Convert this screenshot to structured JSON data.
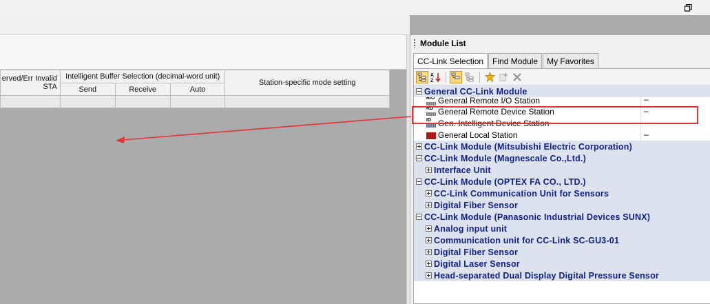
{
  "grid": {
    "col_reserved": "erved/Err Invalid STA",
    "col_buffer": "Intelligent Buffer Selection (decimal-word unit)",
    "col_send": "Send",
    "col_receive": "Receive",
    "col_auto": "Auto",
    "col_station_mode": "Station-specific mode setting"
  },
  "module_list": {
    "title": "Module List",
    "tabs": [
      {
        "label": "CC-Link Selection",
        "active": true
      },
      {
        "label": "Find Module",
        "active": false
      },
      {
        "label": "My Favorites",
        "active": false
      }
    ],
    "toolbar": {
      "sort_icon": "sort-az-icon",
      "favorite_icon": "star-icon",
      "add_icon": "add-icon",
      "delete_icon": "delete-icon"
    },
    "rows": [
      {
        "kind": "cat",
        "expander": "minus",
        "label": "General CC-Link Module"
      },
      {
        "kind": "item",
        "icon": "RIO",
        "label": "General Remote I/O Station",
        "value": "–"
      },
      {
        "kind": "item",
        "icon": "RD",
        "label": "General Remote Device Station",
        "value": "–"
      },
      {
        "kind": "item",
        "icon": "ID",
        "label": "Gen. Intelligent Device Station",
        "value": "–"
      },
      {
        "kind": "item",
        "icon": "LOCAL",
        "label": "General Local Station",
        "value": "–"
      },
      {
        "kind": "cat",
        "expander": "plus",
        "label": "CC-Link Module (Mitsubishi Electric Corporation)"
      },
      {
        "kind": "cat",
        "expander": "minus",
        "label": "CC-Link Module (Magnescale Co.,Ltd.)"
      },
      {
        "kind": "sub",
        "expander": "plus",
        "label": "Interface Unit"
      },
      {
        "kind": "cat",
        "expander": "minus",
        "label": "CC-Link Module (OPTEX FA CO., LTD.)"
      },
      {
        "kind": "sub",
        "expander": "plus",
        "label": "CC-Link Communication Unit for Sensors"
      },
      {
        "kind": "sub",
        "expander": "plus",
        "label": "Digital Fiber Sensor"
      },
      {
        "kind": "cat",
        "expander": "minus",
        "label": "CC-Link Module (Panasonic Industrial Devices SUNX)"
      },
      {
        "kind": "sub",
        "expander": "plus",
        "label": "Analog input unit"
      },
      {
        "kind": "sub",
        "expander": "plus",
        "label": "Communication unit for CC-Link SC-GU3-01"
      },
      {
        "kind": "sub",
        "expander": "plus",
        "label": "Digital Fiber Sensor"
      },
      {
        "kind": "sub",
        "expander": "plus",
        "label": "Digital Laser Sensor"
      },
      {
        "kind": "sub",
        "expander": "plus",
        "label": "Head-separated Dual Display Digital Pressure Sensor"
      }
    ]
  },
  "annotation": {
    "highlight_color": "#e53232",
    "arrow_color": "#e53232"
  }
}
